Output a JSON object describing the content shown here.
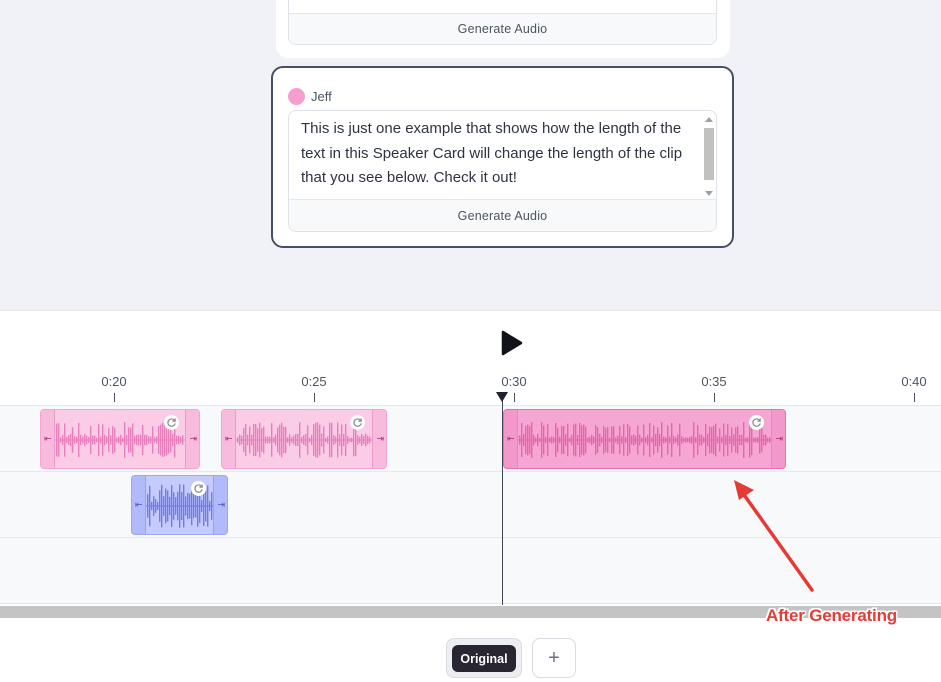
{
  "cards": {
    "previous": {
      "generate_label": "Generate Audio"
    },
    "active": {
      "speaker_name": "Jeff",
      "speaker_color": "#f59fd0",
      "text": "This is just one example that shows how the length of the text in this Speaker Card will change the length of the clip that you see below. Check it out!",
      "generate_label": "Generate Audio"
    }
  },
  "timeline": {
    "play_icon": "play-icon",
    "ticks": [
      "0:20",
      "0:25",
      "0:30",
      "0:35",
      "0:40"
    ],
    "tracks": [
      {
        "speaker": "Jeff",
        "color": "#f59fd0",
        "clips": [
          "clip-1",
          "clip-2",
          "clip-3-generated"
        ]
      },
      {
        "speaker": "",
        "color": "#9aa6f8",
        "clips": [
          "clip-4"
        ]
      },
      {
        "speaker": "",
        "clips": []
      }
    ],
    "playhead": "0:30"
  },
  "versions": {
    "tabs": [
      "Original"
    ],
    "add_label": "+"
  },
  "annotation": {
    "text": "After Generating",
    "color": "#e53b36"
  }
}
